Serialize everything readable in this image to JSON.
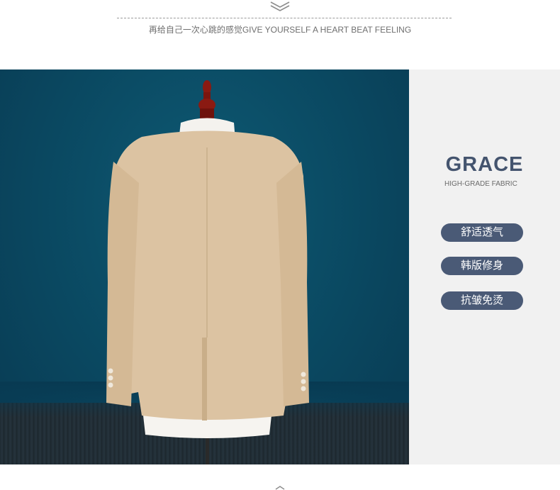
{
  "header": {
    "tagline": "再给自己一次心跳的感觉GIVE YOURSELF A HEART BEAT FEELING",
    "icon": "layers-icon"
  },
  "product_image": {
    "subject": "beige suit jacket back view on mannequin",
    "colors": {
      "backdrop": "#0b4d66",
      "jacket": "#dcc3a2",
      "shirt": "#f4f2ee",
      "mannequin_head": "#8a1a12"
    }
  },
  "feature_panel": {
    "title": "GRACE",
    "subtitle": "HIGH-GRADE FABRIC",
    "tags": [
      "舒适透气",
      "韩版修身",
      "抗皱免烫"
    ],
    "colors": {
      "background": "#f1f1f1",
      "title": "#44546e",
      "pill": "#4a5a76"
    }
  }
}
